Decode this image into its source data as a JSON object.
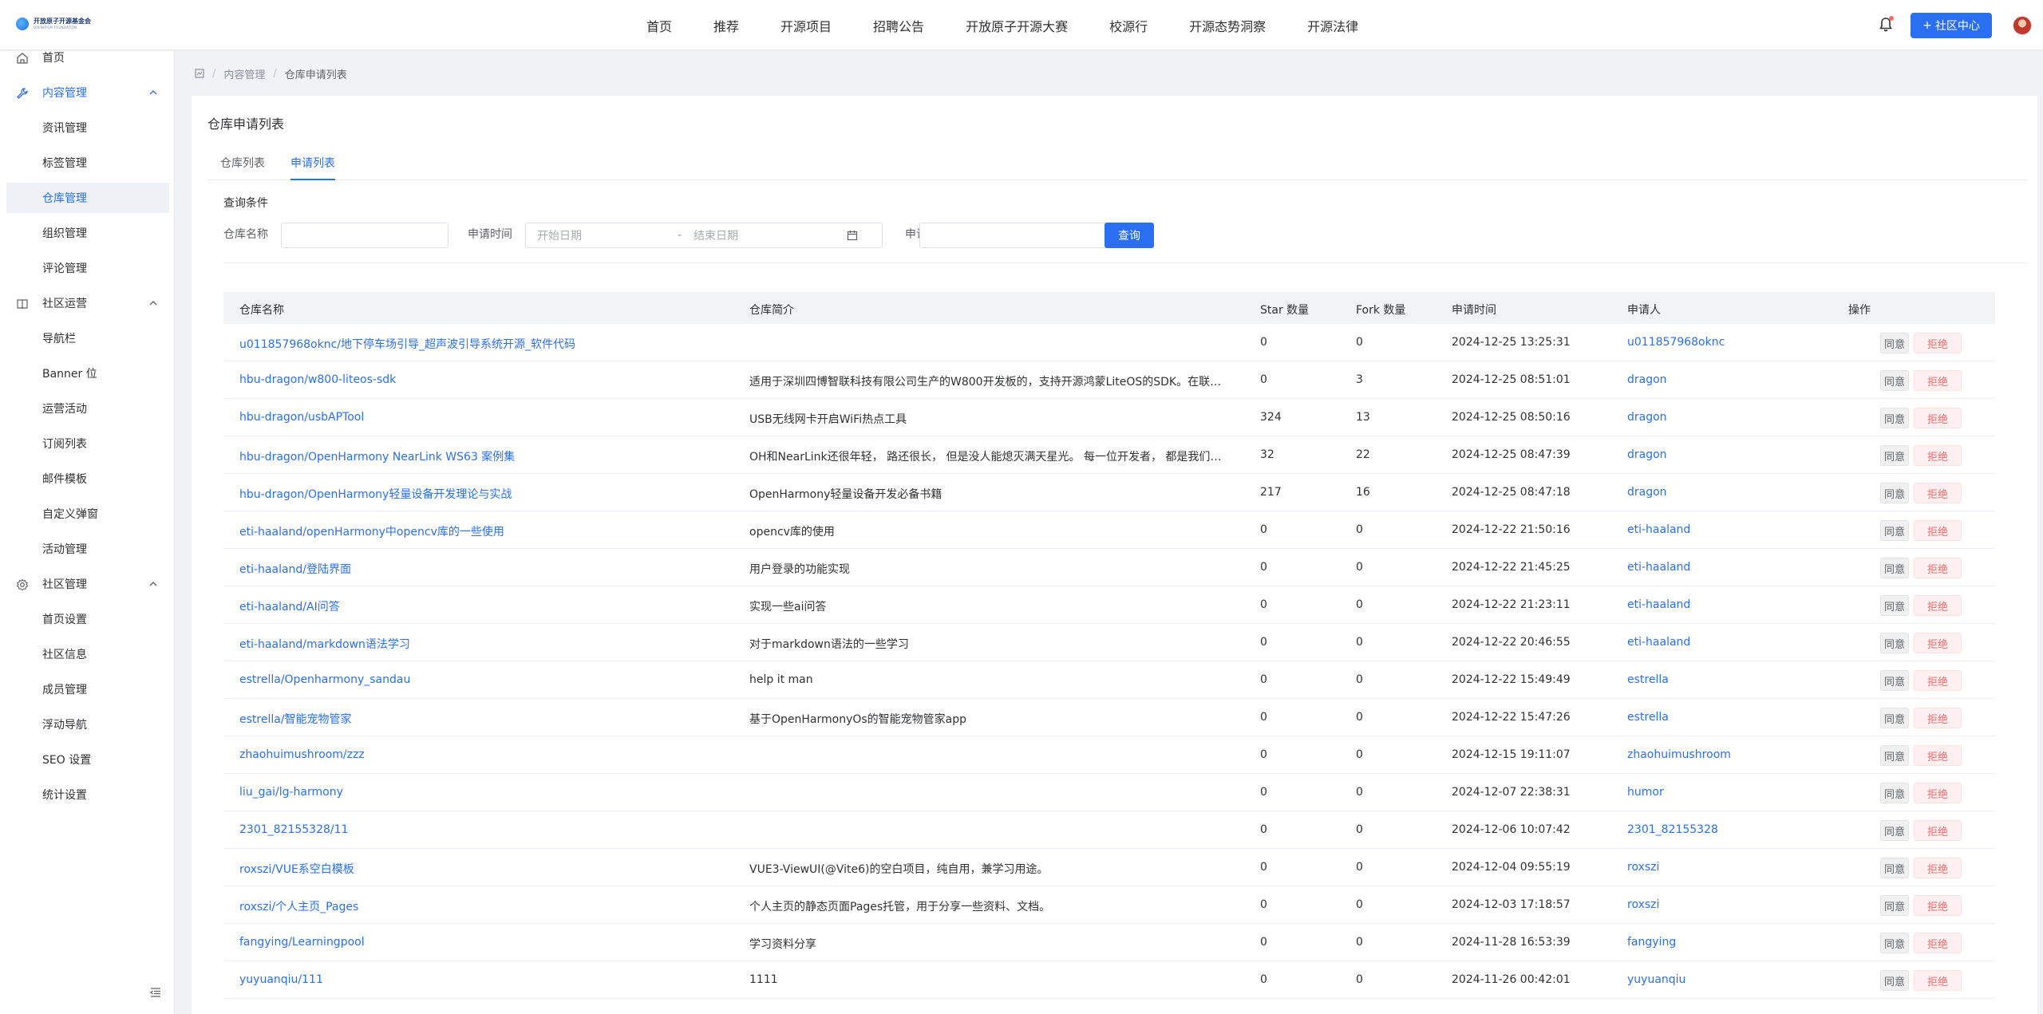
{
  "header": {
    "logo_line1": "开放原子开源基金会",
    "logo_line2": "OPENATOM FOUNDATION",
    "nav": [
      "首页",
      "推荐",
      "开源项目",
      "招聘公告",
      "开放原子开源大赛",
      "校源行",
      "开源态势洞察",
      "开源法律"
    ],
    "community_button": "社区中心",
    "accent": "#2a6ff1"
  },
  "sidebar": {
    "items": [
      {
        "label": "首页",
        "icon": "home-icon",
        "type": "top"
      },
      {
        "label": "内容管理",
        "icon": "wrench-icon",
        "type": "group",
        "open": true,
        "highlight": true
      },
      {
        "label": "资讯管理",
        "type": "sub"
      },
      {
        "label": "标签管理",
        "type": "sub"
      },
      {
        "label": "仓库管理",
        "type": "sub",
        "active": true
      },
      {
        "label": "组织管理",
        "type": "sub"
      },
      {
        "label": "评论管理",
        "type": "sub"
      },
      {
        "label": "社区运营",
        "icon": "book-icon",
        "type": "group",
        "open": true
      },
      {
        "label": "导航栏",
        "type": "sub"
      },
      {
        "label": "Banner 位",
        "type": "sub"
      },
      {
        "label": "运营活动",
        "type": "sub"
      },
      {
        "label": "订阅列表",
        "type": "sub"
      },
      {
        "label": "邮件模板",
        "type": "sub"
      },
      {
        "label": "自定义弹窗",
        "type": "sub"
      },
      {
        "label": "活动管理",
        "type": "sub"
      },
      {
        "label": "社区管理",
        "icon": "gear-icon",
        "type": "group",
        "open": true
      },
      {
        "label": "首页设置",
        "type": "sub"
      },
      {
        "label": "社区信息",
        "type": "sub"
      },
      {
        "label": "成员管理",
        "type": "sub"
      },
      {
        "label": "浮动导航",
        "type": "sub"
      },
      {
        "label": "SEO 设置",
        "type": "sub"
      },
      {
        "label": "统计设置",
        "type": "sub"
      }
    ]
  },
  "breadcrumb": {
    "root": "",
    "parent": "内容管理",
    "current": "仓库申请列表"
  },
  "page": {
    "title": "仓库申请列表",
    "tabs": [
      {
        "label": "仓库列表",
        "active": false
      },
      {
        "label": "申请列表",
        "active": true
      }
    ]
  },
  "query": {
    "title": "查询条件",
    "repo_label": "仓库名称",
    "repo_value": "",
    "time_label": "申请时间",
    "start_placeholder": "开始日期",
    "range_sep": "-",
    "end_placeholder": "结束日期",
    "applicant_label": "申请人",
    "applicant_value": "",
    "search_button": "查询"
  },
  "table": {
    "columns": [
      "仓库名称",
      "仓库简介",
      "Star 数量",
      "Fork 数量",
      "申请时间",
      "申请人",
      "操作"
    ],
    "agree_label": "同意",
    "reject_label": "拒绝",
    "rows": [
      {
        "name": "u011857968oknc/地下停车场引导_超声波引导系统开源_软件代码",
        "desc": "",
        "star": "0",
        "fork": "0",
        "time": "2024-12-25 13:25:31",
        "user": "u011857968oknc"
      },
      {
        "name": "hbu-dragon/w800-liteos-sdk",
        "desc": "适用于深圳四博智联科技有限公司生产的W800开发板的，支持开源鸿蒙LiteOS的SDK。在联盛...",
        "star": "0",
        "fork": "3",
        "time": "2024-12-25 08:51:01",
        "user": "dragon"
      },
      {
        "name": "hbu-dragon/usbAPTool",
        "desc": "USB无线网卡开启WiFi热点工具",
        "star": "324",
        "fork": "13",
        "time": "2024-12-25 08:50:16",
        "user": "dragon"
      },
      {
        "name": "hbu-dragon/OpenHarmony NearLink WS63 案例集",
        "desc": "OH和NearLink还很年轻， 路还很长， 但是没人能熄灭满天星光。 每一位开发者， 都是我们要...",
        "star": "32",
        "fork": "22",
        "time": "2024-12-25 08:47:39",
        "user": "dragon"
      },
      {
        "name": "hbu-dragon/OpenHarmony轻量设备开发理论与实战",
        "desc": "OpenHarmony轻量设备开发必备书籍",
        "star": "217",
        "fork": "16",
        "time": "2024-12-25 08:47:18",
        "user": "dragon"
      },
      {
        "name": "eti-haaland/openHarmony中opencv库的一些使用",
        "desc": "opencv库的使用",
        "star": "0",
        "fork": "0",
        "time": "2024-12-22 21:50:16",
        "user": "eti-haaland"
      },
      {
        "name": "eti-haaland/登陆界面",
        "desc": "用户登录的功能实现",
        "star": "0",
        "fork": "0",
        "time": "2024-12-22 21:45:25",
        "user": "eti-haaland"
      },
      {
        "name": "eti-haaland/AI问答",
        "desc": "实现一些ai问答",
        "star": "0",
        "fork": "0",
        "time": "2024-12-22 21:23:11",
        "user": "eti-haaland"
      },
      {
        "name": "eti-haaland/markdown语法学习",
        "desc": "对于markdown语法的一些学习",
        "star": "0",
        "fork": "0",
        "time": "2024-12-22 20:46:55",
        "user": "eti-haaland"
      },
      {
        "name": "estrella/Openharmony_sandau",
        "desc": "help it man",
        "star": "0",
        "fork": "0",
        "time": "2024-12-22 15:49:49",
        "user": "estrella"
      },
      {
        "name": "estrella/智能宠物管家",
        "desc": "基于OpenHarmonyOs的智能宠物管家app",
        "star": "0",
        "fork": "0",
        "time": "2024-12-22 15:47:26",
        "user": "estrella"
      },
      {
        "name": "zhaohuimushroom/zzz",
        "desc": "",
        "star": "0",
        "fork": "0",
        "time": "2024-12-15 19:11:07",
        "user": "zhaohuimushroom"
      },
      {
        "name": "liu_gai/lg-harmony",
        "desc": "",
        "star": "0",
        "fork": "0",
        "time": "2024-12-07 22:38:31",
        "user": "humor"
      },
      {
        "name": "2301_82155328/11",
        "desc": "",
        "star": "0",
        "fork": "0",
        "time": "2024-12-06 10:07:42",
        "user": "2301_82155328"
      },
      {
        "name": "roxszi/VUE系空白模板",
        "desc": "VUE3-ViewUI(@Vite6)的空白项目，纯自用，兼学习用途。",
        "star": "0",
        "fork": "0",
        "time": "2024-12-04 09:55:19",
        "user": "roxszi"
      },
      {
        "name": "roxszi/个人主页_Pages",
        "desc": "个人主页的静态页面Pages托管，用于分享一些资料、文档。",
        "star": "0",
        "fork": "0",
        "time": "2024-12-03 17:18:57",
        "user": "roxszi"
      },
      {
        "name": "fangying/Learningpool",
        "desc": "学习资料分享",
        "star": "0",
        "fork": "0",
        "time": "2024-11-28 16:53:39",
        "user": "fangying"
      },
      {
        "name": "yuyuanqiu/111",
        "desc": "1111",
        "star": "0",
        "fork": "0",
        "time": "2024-11-26 00:42:01",
        "user": "yuyuanqiu"
      }
    ]
  }
}
